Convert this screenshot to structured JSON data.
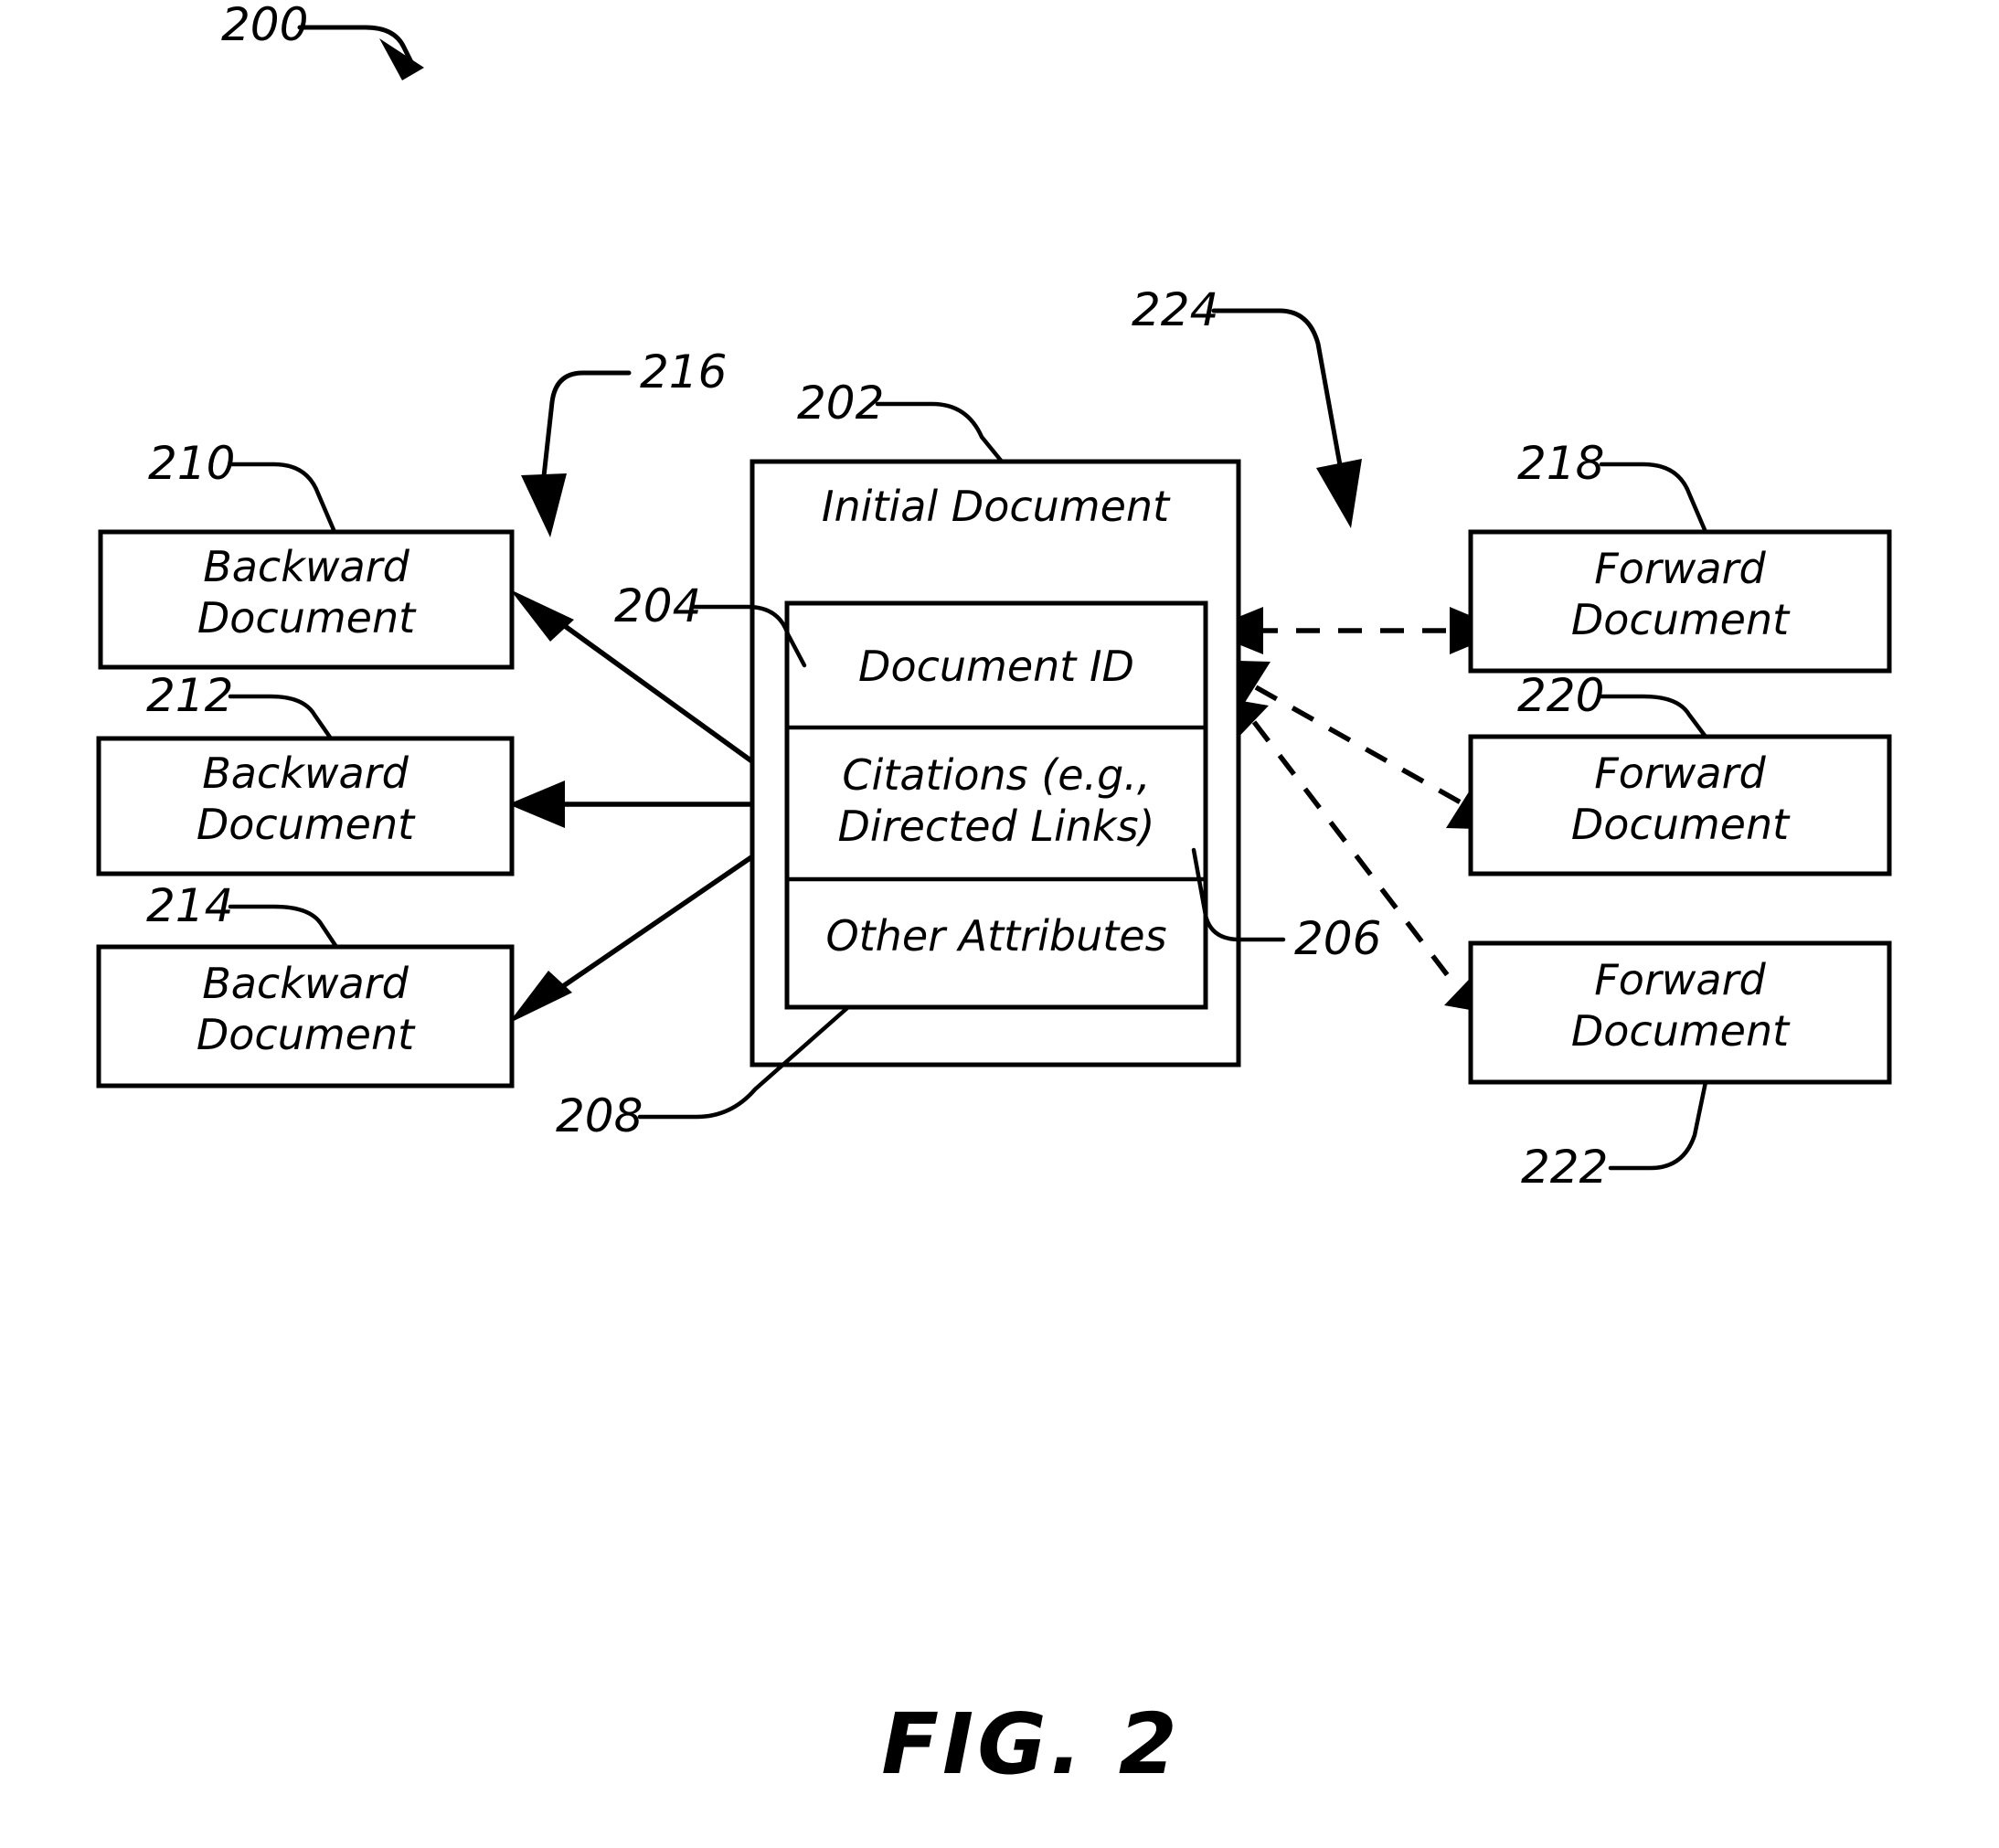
{
  "figure": {
    "caption": "FIG. 2",
    "overall_ref": "200"
  },
  "center": {
    "outer_ref": "202",
    "outer_title": "Initial Document",
    "inner_ref": "204",
    "rows": [
      {
        "ref": "206",
        "label": "Document ID"
      },
      {
        "ref": "",
        "label_line1": "Citations (e.g.,",
        "label_line2": "Directed Links)"
      },
      {
        "ref": "208",
        "label": "Other Attributes"
      }
    ]
  },
  "backward": {
    "group_ref": "216",
    "items": [
      {
        "ref": "210",
        "line1": "Backward",
        "line2": "Document"
      },
      {
        "ref": "212",
        "line1": "Backward",
        "line2": "Document"
      },
      {
        "ref": "214",
        "line1": "Backward",
        "line2": "Document"
      }
    ]
  },
  "forward": {
    "group_ref": "224",
    "items": [
      {
        "ref": "218",
        "line1": "Forward",
        "line2": "Document"
      },
      {
        "ref": "220",
        "line1": "Forward",
        "line2": "Document"
      },
      {
        "ref": "222",
        "line1": "Forward",
        "line2": "Document"
      }
    ]
  }
}
